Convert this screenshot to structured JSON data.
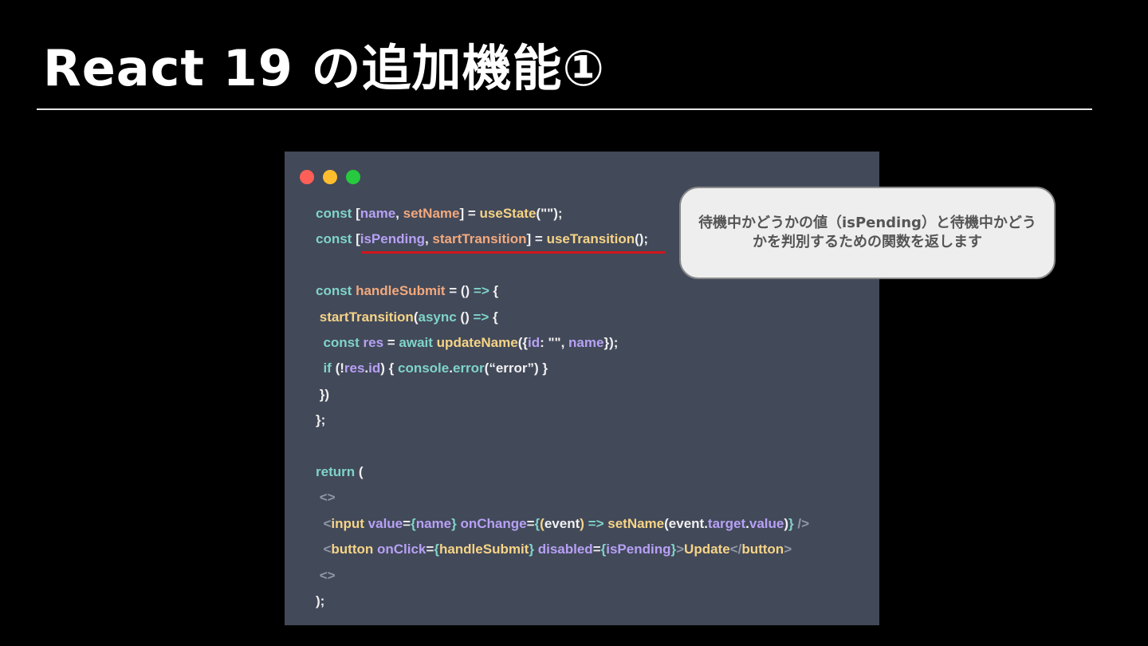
{
  "title": "React 19 の追加機能①",
  "window_controls": [
    "close",
    "minimize",
    "maximize"
  ],
  "callout": "待機中かどうかの値（isPending）と待機中かどうかを判別するための関数を返します",
  "code": [
    [
      [
        "k",
        "const "
      ],
      [
        "p",
        "["
      ],
      [
        "v",
        "name"
      ],
      [
        "p",
        ", "
      ],
      [
        "o",
        "setName"
      ],
      [
        "p",
        "] = "
      ],
      [
        "f",
        "useState"
      ],
      [
        "p",
        "(\"\");"
      ]
    ],
    [
      [
        "k",
        "const "
      ],
      [
        "p",
        "["
      ],
      [
        "v",
        "isPending"
      ],
      [
        "p",
        ", "
      ],
      [
        "o",
        "startTransition"
      ],
      [
        "p",
        "] = "
      ],
      [
        "f",
        "useTransition"
      ],
      [
        "p",
        "();"
      ]
    ],
    [],
    [
      [
        "k",
        "const "
      ],
      [
        "o",
        "handleSubmit"
      ],
      [
        "p",
        " = () "
      ],
      [
        "k",
        "=>"
      ],
      [
        "p",
        " {"
      ]
    ],
    [
      [
        "p",
        " "
      ],
      [
        "f",
        "startTransition"
      ],
      [
        "p",
        "("
      ],
      [
        "k",
        "async"
      ],
      [
        "p",
        " () "
      ],
      [
        "k",
        "=>"
      ],
      [
        "p",
        " {"
      ]
    ],
    [
      [
        "p",
        "  "
      ],
      [
        "k",
        "const "
      ],
      [
        "v",
        "res"
      ],
      [
        "p",
        " = "
      ],
      [
        "k",
        "await "
      ],
      [
        "f",
        "updateName"
      ],
      [
        "p",
        "({"
      ],
      [
        "v",
        "id"
      ],
      [
        "p",
        ": \"\", "
      ],
      [
        "v",
        "name"
      ],
      [
        "p",
        "});"
      ]
    ],
    [
      [
        "p",
        "  "
      ],
      [
        "k",
        "if"
      ],
      [
        "p",
        " (!"
      ],
      [
        "v",
        "res"
      ],
      [
        "p",
        "."
      ],
      [
        "v",
        "id"
      ],
      [
        "p",
        ") { "
      ],
      [
        "k",
        "console"
      ],
      [
        "p",
        "."
      ],
      [
        "k",
        "error"
      ],
      [
        "p",
        "(“error”) }"
      ]
    ],
    [
      [
        "p",
        " })"
      ]
    ],
    [
      [
        "p",
        "};"
      ]
    ],
    [],
    [
      [
        "k",
        "return"
      ],
      [
        "p",
        " ("
      ]
    ],
    [
      [
        "p",
        " "
      ],
      [
        "g",
        "<>"
      ]
    ],
    [
      [
        "p",
        "  "
      ],
      [
        "g",
        "<"
      ],
      [
        "f",
        "input "
      ],
      [
        "v",
        "value"
      ],
      [
        "p",
        "="
      ],
      [
        "k",
        "{"
      ],
      [
        "v",
        "name"
      ],
      [
        "k",
        "}"
      ],
      [
        "p",
        " "
      ],
      [
        "v",
        "onChange"
      ],
      [
        "p",
        "="
      ],
      [
        "k",
        "{"
      ],
      [
        "f",
        "("
      ],
      [
        "p",
        "event"
      ],
      [
        "f",
        ")"
      ],
      [
        "p",
        " "
      ],
      [
        "k",
        "=>"
      ],
      [
        "p",
        " "
      ],
      [
        "f",
        "setName"
      ],
      [
        "p",
        "(event."
      ],
      [
        "v",
        "target"
      ],
      [
        "p",
        "."
      ],
      [
        "v",
        "value"
      ],
      [
        "p",
        ")"
      ],
      [
        "k",
        "}"
      ],
      [
        "p",
        " "
      ],
      [
        "g",
        "/>"
      ]
    ],
    [
      [
        "p",
        "  "
      ],
      [
        "g",
        "<"
      ],
      [
        "f",
        "button "
      ],
      [
        "v",
        "onClick"
      ],
      [
        "p",
        "="
      ],
      [
        "k",
        "{"
      ],
      [
        "f",
        "handleSubmit"
      ],
      [
        "k",
        "}"
      ],
      [
        "p",
        " "
      ],
      [
        "v",
        "disabled"
      ],
      [
        "p",
        "="
      ],
      [
        "k",
        "{"
      ],
      [
        "v",
        "isPending"
      ],
      [
        "k",
        "}"
      ],
      [
        "g",
        ">"
      ],
      [
        "f",
        "Update"
      ],
      [
        "g",
        "</"
      ],
      [
        "f",
        "button"
      ],
      [
        "g",
        ">"
      ]
    ],
    [
      [
        "p",
        " "
      ],
      [
        "g",
        "<>"
      ]
    ],
    [
      [
        "p",
        ");"
      ]
    ]
  ]
}
